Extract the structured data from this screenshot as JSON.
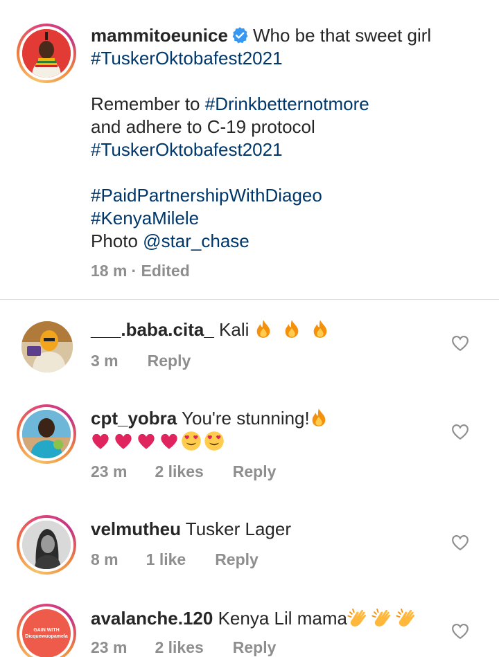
{
  "caption": {
    "username": "mammitoeunice",
    "line1": "Who be that sweet girl",
    "tag1": "#TuskerOktobafest2021",
    "line3a": "Remember to ",
    "tag2": "#Drinkbetternotmore",
    "line4": "and adhere to C-19 protocol",
    "tag3": "#TuskerOktobafest2021",
    "tag4": "#PaidPartnershipWithDiageo",
    "tag5": "#KenyaMilele",
    "photo_label": "Photo ",
    "mention": "@star_chase",
    "time": "18 m",
    "edited": "· Edited"
  },
  "comments": [
    {
      "username": "___.baba.cita_",
      "text": "Kali",
      "time": "3 m",
      "likes": "",
      "reply": "Reply"
    },
    {
      "username": "cpt_yobra",
      "text": "You're stunning!",
      "time": "23 m",
      "likes": "2 likes",
      "reply": "Reply"
    },
    {
      "username": "velmutheu",
      "text": "Tusker Lager",
      "time": "8 m",
      "likes": "1 like",
      "reply": "Reply"
    },
    {
      "username": "avalanche.120",
      "text": "Kenya Lil mama",
      "time": "23 m",
      "likes": "2 likes",
      "reply": "Reply",
      "avatar_text": "GAIN WITH\nDicquewuopamela"
    }
  ],
  "icons": {
    "verified": "verified-badge-icon",
    "fire": "fire-emoji",
    "heart": "red-heart-emoji",
    "heart_eyes": "heart-eyes-emoji",
    "clap": "clapping-hands-emoji",
    "like": "heart-outline-icon"
  },
  "colors": {
    "hashtag": "#00376b",
    "meta": "#8e8e8e",
    "verified": "#3897f0"
  }
}
